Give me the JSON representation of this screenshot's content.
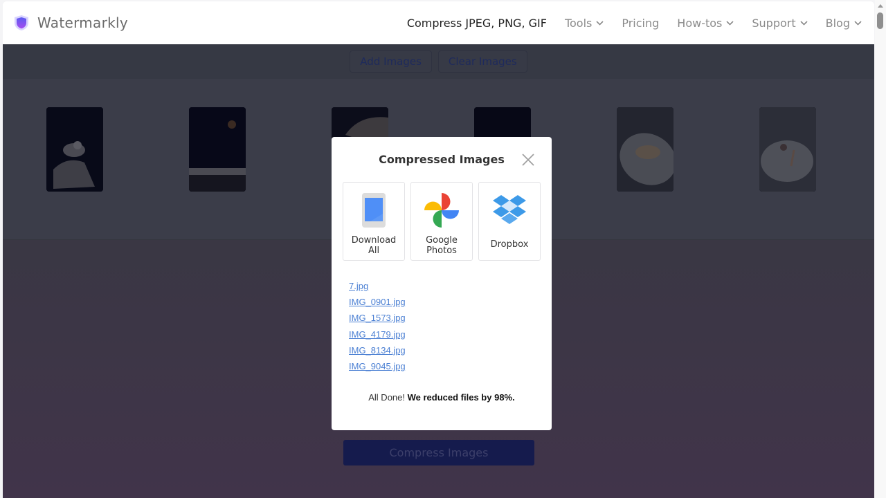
{
  "header": {
    "brand": "Watermarkly",
    "nav": [
      {
        "label": "Compress JPEG, PNG, GIF",
        "active": true,
        "dropdown": false
      },
      {
        "label": "Tools",
        "active": false,
        "dropdown": true
      },
      {
        "label": "Pricing",
        "active": false,
        "dropdown": false
      },
      {
        "label": "How-tos",
        "active": false,
        "dropdown": true
      },
      {
        "label": "Support",
        "active": false,
        "dropdown": true
      },
      {
        "label": "Blog",
        "active": false,
        "dropdown": true
      }
    ]
  },
  "toolbar": {
    "add_images": "Add Images",
    "clear_images": "Clear Images"
  },
  "gallery": {
    "thumbnails": [
      {
        "alt": "dessert photo 1"
      },
      {
        "alt": "cake photo 2"
      },
      {
        "alt": "dessert photo 3"
      },
      {
        "alt": "dark photo 4"
      },
      {
        "alt": "plated dessert photo 5"
      },
      {
        "alt": "plated dessert photo 6"
      }
    ]
  },
  "main": {
    "compress_button": "Compress Images"
  },
  "modal": {
    "title": "Compressed Images",
    "close_icon": "close-icon",
    "options": [
      {
        "label_line1": "Download",
        "label_line2": "All",
        "icon": "device-download-icon"
      },
      {
        "label_line1": "Google",
        "label_line2": "Photos",
        "icon": "google-photos-icon"
      },
      {
        "label_line1": "Dropbox",
        "label_line2": "",
        "icon": "dropbox-icon"
      }
    ],
    "files": [
      "7.jpg",
      "IMG_0901.jpg",
      "IMG_1573.jpg",
      "IMG_4179.jpg",
      "IMG_8134.jpg",
      "IMG_9045.jpg"
    ],
    "status_prefix": "All Done! ",
    "status_bold": "We reduced files by 98%."
  },
  "colors": {
    "brand_shield": "#6a4cf0",
    "link": "#4a7fd3",
    "compress_button": "#151b4d"
  }
}
